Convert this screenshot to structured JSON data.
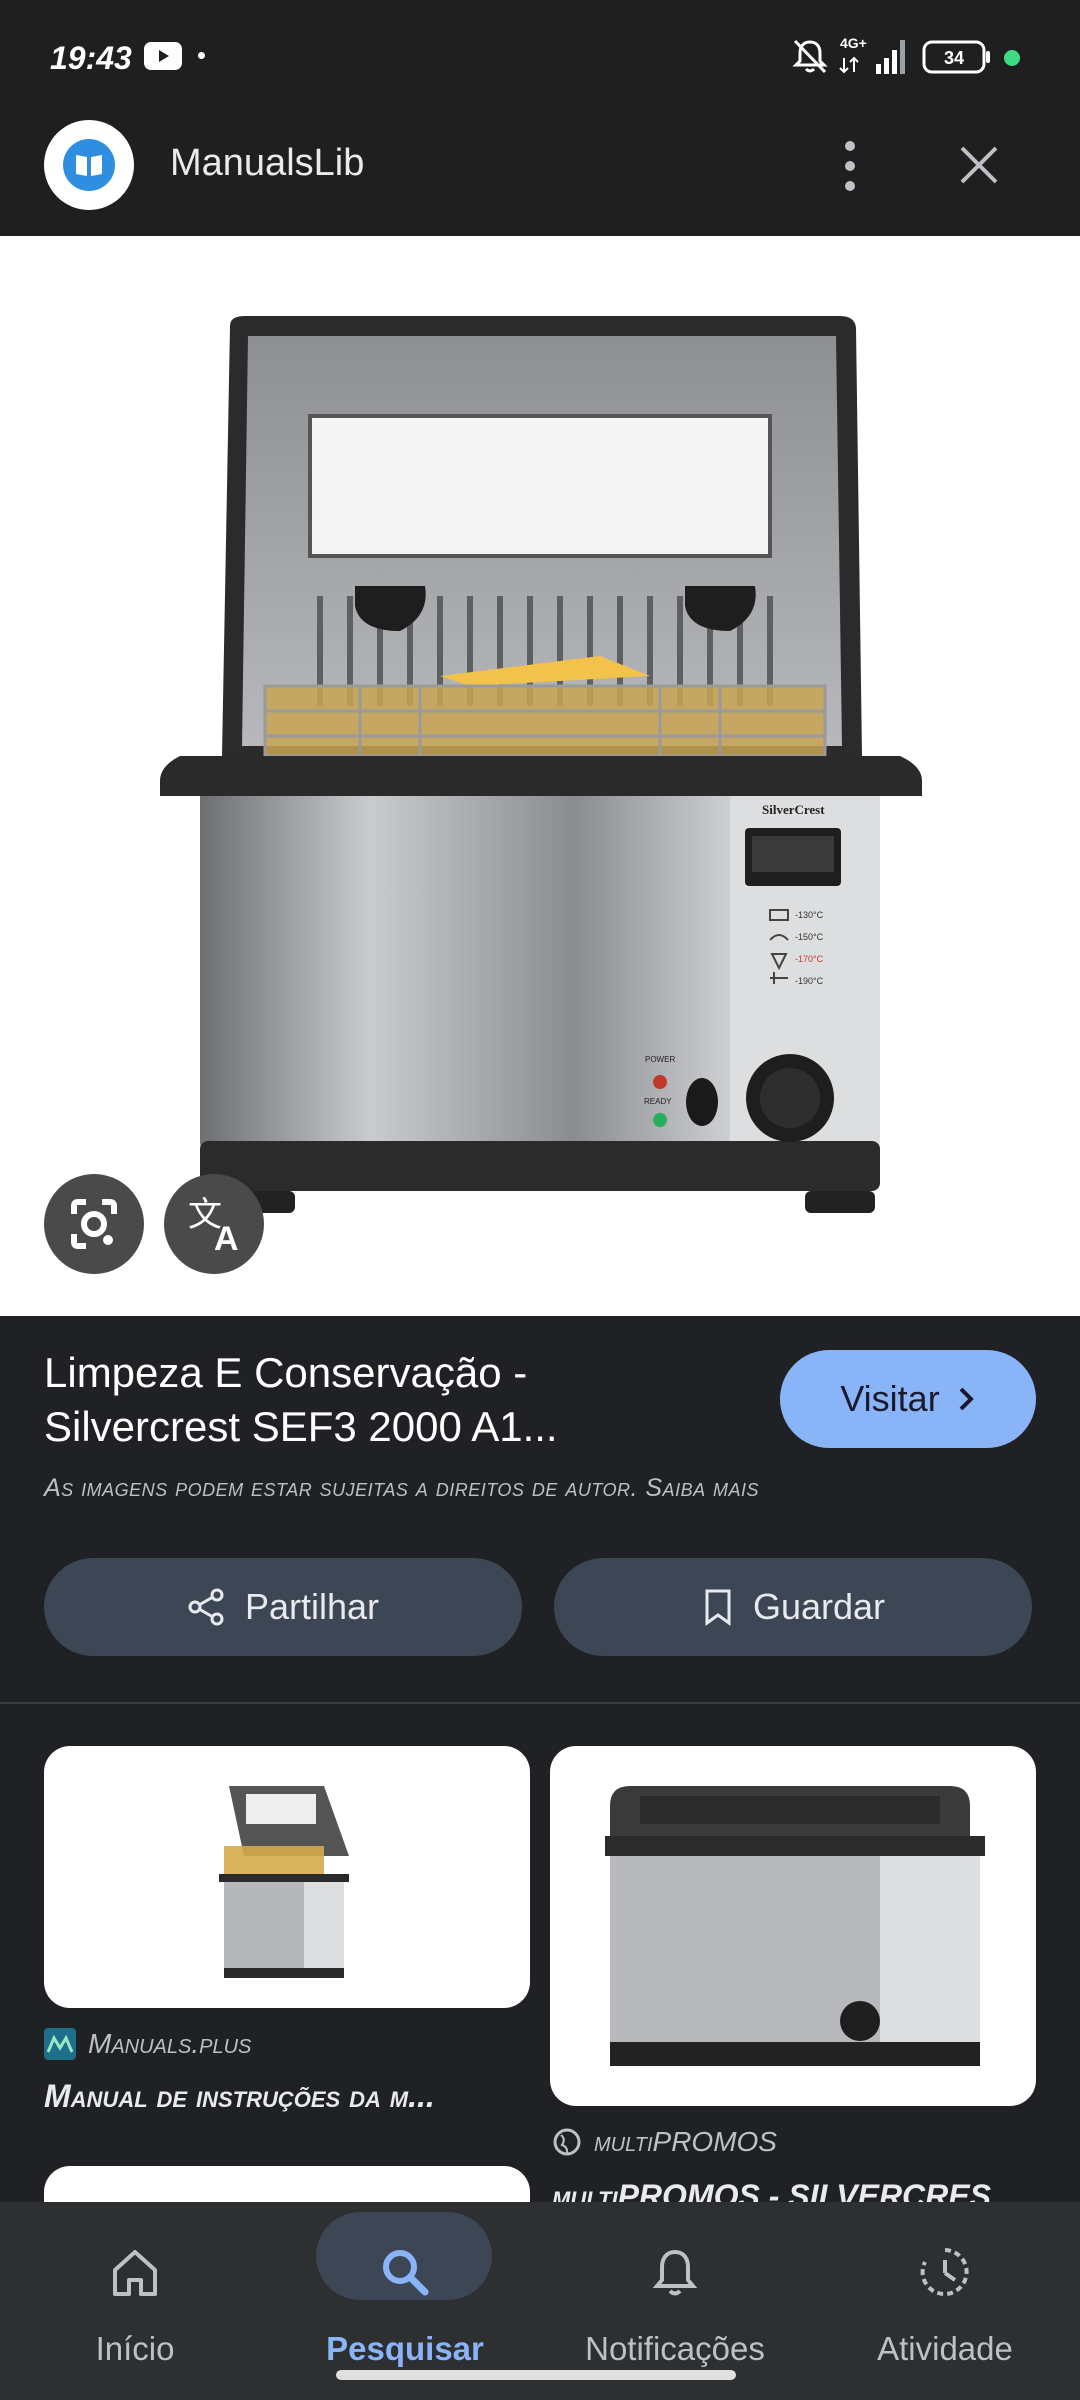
{
  "status_bar": {
    "time": "19:43",
    "network": "4G+",
    "battery": "34"
  },
  "header": {
    "app_name": "ManualsLib"
  },
  "result": {
    "title_line1": "Limpeza E Conservação -",
    "title_line2": "Silvercrest SEF3 2000 A1...",
    "visit_label": "Visitar",
    "copyright_text": "As imagens podem estar sujeitas a direitos de autor. Saiba mais",
    "share_label": "Partilhar",
    "save_label": "Guardar"
  },
  "related": [
    {
      "source": "Manuals.plus",
      "title": "Manual de instruções da m..."
    },
    {
      "source": "multiPROMOS",
      "title": "multiPROMOS - SILVERCRES..."
    }
  ],
  "fryer_labels": {
    "brand": "SilverCrest",
    "power": "POWER",
    "ready": "READY",
    "temp1": "-130°C",
    "temp2": "-150°C",
    "temp3": "-170°C",
    "temp4": "-190°C"
  },
  "bottom_nav": [
    {
      "label": "Início",
      "icon": "home-icon"
    },
    {
      "label": "Pesquisar",
      "icon": "search-icon",
      "active": true
    },
    {
      "label": "Notificações",
      "icon": "bell-icon"
    },
    {
      "label": "Atividade",
      "icon": "activity-icon"
    }
  ],
  "colors": {
    "accent": "#8ab4f8",
    "background": "#202124",
    "pill": "#3c4655"
  }
}
